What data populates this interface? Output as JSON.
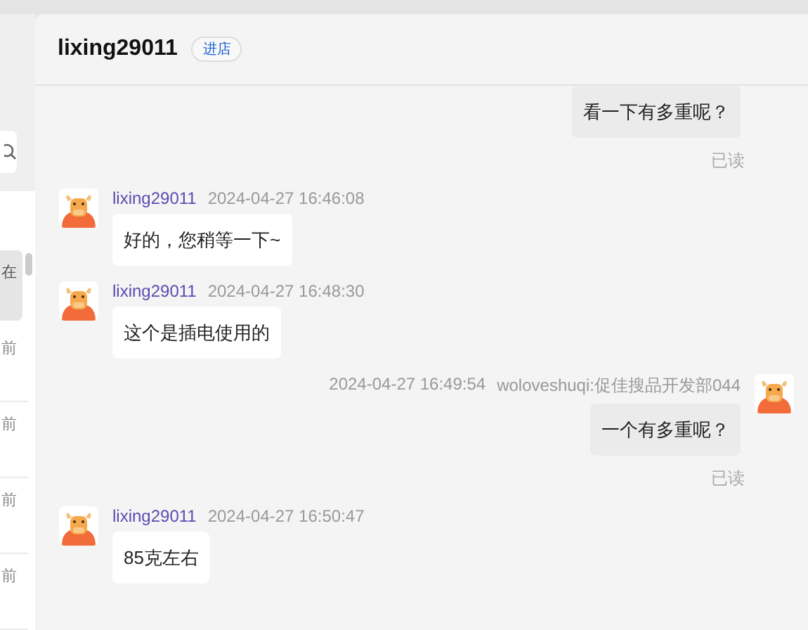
{
  "sidebar": {
    "items": [
      {
        "text": "在",
        "selected": true
      },
      {
        "text": "前",
        "selected": false
      },
      {
        "text": "前",
        "selected": false
      },
      {
        "text": "前",
        "selected": false
      },
      {
        "text": "前",
        "selected": false
      }
    ]
  },
  "header": {
    "title": "lixing29011",
    "badge": "进店"
  },
  "messages": [
    {
      "kind": "outgoing",
      "text": "看一下有多重呢？",
      "status": "已读"
    },
    {
      "kind": "incoming",
      "sender": "lixing29011",
      "time": "2024-04-27 16:46:08",
      "text": "好的，您稍等一下~"
    },
    {
      "kind": "incoming",
      "sender": "lixing29011",
      "time": "2024-04-27 16:48:30",
      "text": "这个是插电使用的"
    },
    {
      "kind": "outgoing",
      "sender": "woloveshuqi:促佳搜品开发部044",
      "time": "2024-04-27 16:49:54",
      "text": "一个有多重呢？",
      "status": "已读"
    },
    {
      "kind": "incoming",
      "sender": "lixing29011",
      "time": "2024-04-27 16:50:47",
      "text": "85克左右"
    }
  ]
}
